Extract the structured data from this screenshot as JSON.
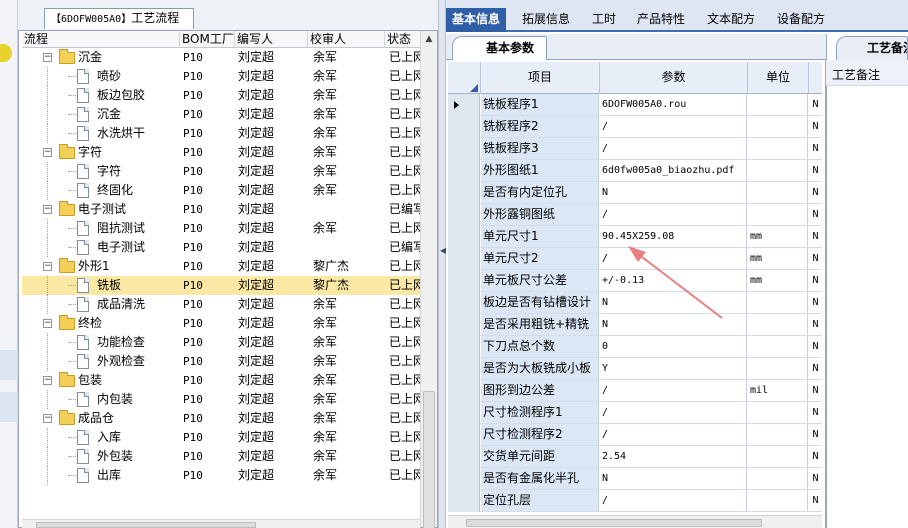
{
  "process_tab": {
    "code": "【6DOFW005A0】",
    "label": "工艺流程"
  },
  "tree": {
    "columns": [
      "流程",
      "BOM工厂",
      "编写人",
      "校审人",
      "状态"
    ],
    "rows": [
      {
        "name": "沉金",
        "level": 0,
        "bom": "P10",
        "writer": "刘定超",
        "reviewer": "余军",
        "status": "已上网"
      },
      {
        "name": "喷砂",
        "level": 1,
        "bom": "P10",
        "writer": "刘定超",
        "reviewer": "余军",
        "status": "已上网"
      },
      {
        "name": "板边包胶",
        "level": 1,
        "bom": "P10",
        "writer": "刘定超",
        "reviewer": "余军",
        "status": "已上网"
      },
      {
        "name": "沉金",
        "level": 1,
        "bom": "P10",
        "writer": "刘定超",
        "reviewer": "余军",
        "status": "已上网"
      },
      {
        "name": "水洗烘干",
        "level": 1,
        "bom": "P10",
        "writer": "刘定超",
        "reviewer": "余军",
        "status": "已上网"
      },
      {
        "name": "字符",
        "level": 0,
        "bom": "P10",
        "writer": "刘定超",
        "reviewer": "余军",
        "status": "已上网"
      },
      {
        "name": "字符",
        "level": 1,
        "bom": "P10",
        "writer": "刘定超",
        "reviewer": "余军",
        "status": "已上网"
      },
      {
        "name": "终固化",
        "level": 1,
        "bom": "P10",
        "writer": "刘定超",
        "reviewer": "余军",
        "status": "已上网"
      },
      {
        "name": "电子测试",
        "level": 0,
        "bom": "P10",
        "writer": "刘定超",
        "reviewer": "",
        "status": "已编写"
      },
      {
        "name": "阻抗测试",
        "level": 1,
        "bom": "P10",
        "writer": "刘定超",
        "reviewer": "余军",
        "status": "已上网"
      },
      {
        "name": "电子测试",
        "level": 1,
        "bom": "P10",
        "writer": "刘定超",
        "reviewer": "",
        "status": "已编写"
      },
      {
        "name": "外形1",
        "level": 0,
        "bom": "P10",
        "writer": "刘定超",
        "reviewer": "黎广杰",
        "status": "已上网"
      },
      {
        "name": "铣板",
        "level": 1,
        "bom": "P10",
        "writer": "刘定超",
        "reviewer": "黎广杰",
        "status": "已上网",
        "selected": true
      },
      {
        "name": "成品清洗",
        "level": 1,
        "bom": "P10",
        "writer": "刘定超",
        "reviewer": "余军",
        "status": "已上网"
      },
      {
        "name": "终检",
        "level": 0,
        "bom": "P10",
        "writer": "刘定超",
        "reviewer": "余军",
        "status": "已上网"
      },
      {
        "name": "功能检查",
        "level": 1,
        "bom": "P10",
        "writer": "刘定超",
        "reviewer": "余军",
        "status": "已上网"
      },
      {
        "name": "外观检查",
        "level": 1,
        "bom": "P10",
        "writer": "刘定超",
        "reviewer": "余军",
        "status": "已上网"
      },
      {
        "name": "包装",
        "level": 0,
        "bom": "P10",
        "writer": "刘定超",
        "reviewer": "余军",
        "status": "已上网"
      },
      {
        "name": "内包装",
        "level": 1,
        "bom": "P10",
        "writer": "刘定超",
        "reviewer": "余军",
        "status": "已上网"
      },
      {
        "name": "成品仓",
        "level": 0,
        "bom": "P10",
        "writer": "刘定超",
        "reviewer": "余军",
        "status": "已上网"
      },
      {
        "name": "入库",
        "level": 1,
        "bom": "P10",
        "writer": "刘定超",
        "reviewer": "余军",
        "status": "已上网"
      },
      {
        "name": "外包装",
        "level": 1,
        "bom": "P10",
        "writer": "刘定超",
        "reviewer": "余军",
        "status": "已上网"
      },
      {
        "name": "出库",
        "level": 1,
        "bom": "P10",
        "writer": "刘定超",
        "reviewer": "余军",
        "status": "已上网"
      }
    ]
  },
  "main_tabs": [
    "基本信息",
    "拓展信息",
    "工时",
    "产品特性",
    "文本配方",
    "设备配方"
  ],
  "active_main_tab": 0,
  "sub_tab": "基本参数",
  "grid": {
    "columns": [
      "项目",
      "参数",
      "单位"
    ],
    "rows": [
      {
        "item": "铣板程序1",
        "param": "6DOFW005A0.rou",
        "unit": "",
        "flag": "N",
        "current": true
      },
      {
        "item": "铣板程序2",
        "param": "/",
        "unit": "",
        "flag": "N"
      },
      {
        "item": "铣板程序3",
        "param": "/",
        "unit": "",
        "flag": "N"
      },
      {
        "item": "外形图纸1",
        "param": "6d0fw005a0_biaozhu.pdf",
        "unit": "",
        "flag": "N"
      },
      {
        "item": "是否有内定位孔",
        "param": "N",
        "unit": "",
        "flag": "N"
      },
      {
        "item": "外形露铜图纸",
        "param": "/",
        "unit": "",
        "flag": "N"
      },
      {
        "item": "单元尺寸1",
        "param": "90.45X259.08",
        "unit": "mm",
        "flag": "N"
      },
      {
        "item": "单元尺寸2",
        "param": "/",
        "unit": "mm",
        "flag": "N"
      },
      {
        "item": "单元板尺寸公差",
        "param": "+/-0.13",
        "unit": "mm",
        "flag": "N"
      },
      {
        "item": "板边是否有钻槽设计",
        "param": "N",
        "unit": "",
        "flag": "N"
      },
      {
        "item": "是否采用粗铣+精铣",
        "param": "N",
        "unit": "",
        "flag": "N"
      },
      {
        "item": "下刀点总个数",
        "param": "0",
        "unit": "",
        "flag": "N"
      },
      {
        "item": "是否为大板铣成小板",
        "param": "Y",
        "unit": "",
        "flag": "N"
      },
      {
        "item": "图形到边公差",
        "param": "/",
        "unit": "mil",
        "flag": "N"
      },
      {
        "item": "尺寸检测程序1",
        "param": "/",
        "unit": "",
        "flag": "N"
      },
      {
        "item": "尺寸检测程序2",
        "param": "/",
        "unit": "",
        "flag": "N"
      },
      {
        "item": "交货单元间距",
        "param": "2.54",
        "unit": "",
        "flag": "N"
      },
      {
        "item": "是否有金属化半孔",
        "param": "N",
        "unit": "",
        "flag": "N"
      },
      {
        "item": "定位孔层",
        "param": "/",
        "unit": "",
        "flag": "N"
      }
    ]
  },
  "right_panel": {
    "tab": "工艺备注",
    "label": "工艺备注"
  },
  "colors": {
    "tab_active": "#2f5fa7",
    "selected_row": "#fbe8a4",
    "item_cell": "#dce7f5",
    "annotation_arrow": "#e88080"
  },
  "icons": [
    "folder-icon",
    "document-icon",
    "expand-minus-icon",
    "scroll-up-icon",
    "scroll-down-icon",
    "splitter-arrow-icon",
    "row-pointer-icon"
  ]
}
